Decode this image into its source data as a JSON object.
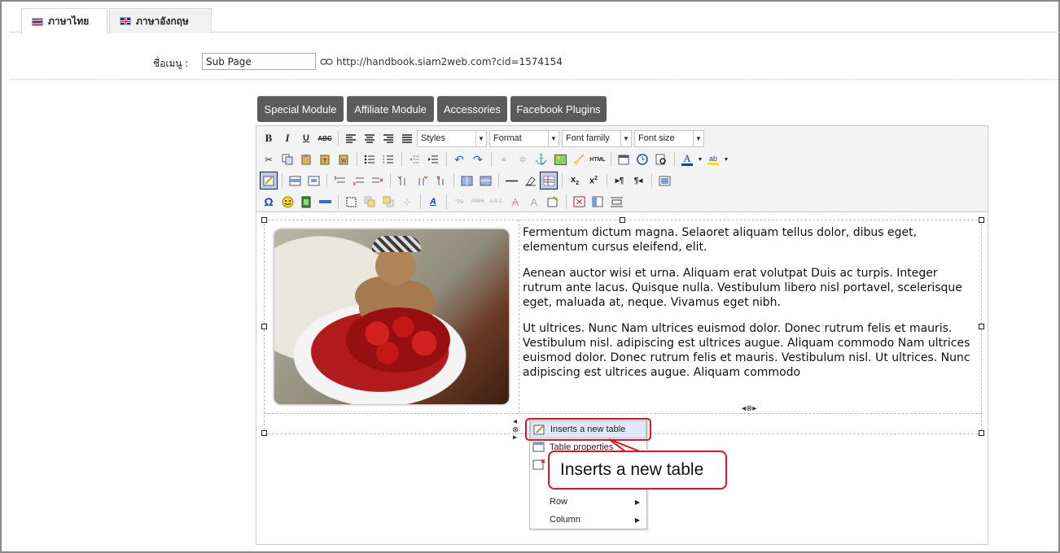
{
  "tabs": [
    {
      "label": "ภาษาไทย",
      "flag": "thai-flag-icon"
    },
    {
      "label": "ภาษาอังกฤษ",
      "flag": "uk-flag-icon"
    }
  ],
  "menu": {
    "label": "ชื่อเมนู :",
    "value": "Sub Page",
    "url": "http://handbook.siam2web.com?cid=1574154"
  },
  "module_buttons": [
    "Special Module",
    "Affiliate Module",
    "Accessories",
    "Facebook Plugins"
  ],
  "toolbar": {
    "styles": "Styles",
    "format": "Format",
    "font_family": "Font family",
    "font_size": "Font size",
    "html_label": "HTML"
  },
  "content": {
    "paragraphs": [
      "Fermentum dictum magna. Selaoret aliquam tellus dolor, dibus eget, elementum cursus eleifend, elit.",
      "Aenean auctor wisi et urna. Aliquam erat volutpat Duis ac turpis. Integer rutrum ante lacus. Quisque nulla. Vestibulum libero nisl portavel, scelerisque eget, maluada at, neque. Vivamus eget nibh.",
      "Ut ultrices. Nunc Nam ultrices euismod dolor. Donec rutrum felis et mauris. Vestibulum nisl. adipiscing est ultrices augue. Aliquam commodo Nam ultrices euismod dolor. Donec rutrum felis et mauris. Vestibulum nisl. Ut ultrices. Nunc adipiscing est ultrices augue. Aliquam commodo"
    ]
  },
  "context_menu": {
    "items": [
      "Inserts a new table",
      "Table properties",
      "",
      "Row",
      "Column"
    ]
  },
  "callout": "Inserts a new table",
  "colors": {
    "module_button_bg": "#5b5b5b",
    "highlight": "#e0141b",
    "menu_hover": "#dfe8f6"
  }
}
